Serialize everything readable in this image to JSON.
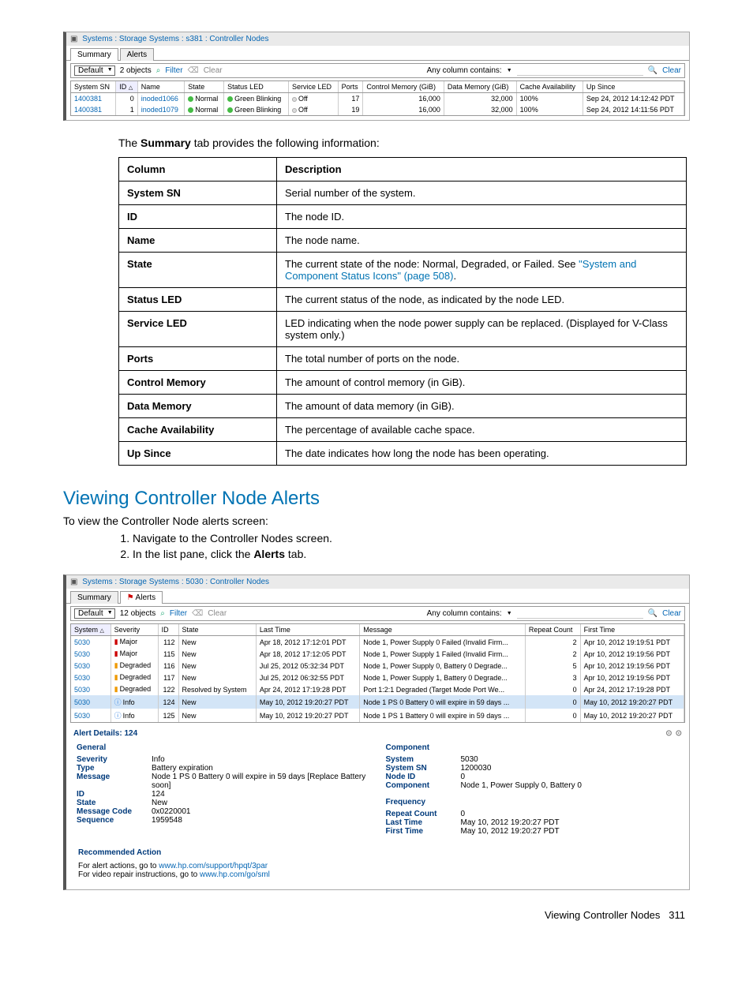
{
  "screenshot1": {
    "title": "Systems : Storage Systems : s381 : Controller Nodes",
    "tabs": [
      "Summary",
      "Alerts"
    ],
    "activeTab": 0,
    "toolbar": {
      "selector": "Default",
      "count": "2 objects",
      "filter": "Filter",
      "clear": "Clear",
      "searchLabel": "Any column contains:",
      "clearRight": "Clear"
    },
    "columns": [
      "System SN",
      "ID",
      "Name",
      "State",
      "Status LED",
      "Service LED",
      "Ports",
      "Control Memory (GiB)",
      "Data Memory (GiB)",
      "Cache Availability",
      "Up Since"
    ],
    "sortCol": 1,
    "rows": [
      {
        "sn": "1400381",
        "id": "0",
        "name": "inoded1066",
        "state": "Normal",
        "status": "Green Blinking",
        "service": "Off",
        "ports": "17",
        "cmem": "16,000",
        "dmem": "32,000",
        "cache": "100%",
        "up": "Sep 24, 2012 14:12:42 PDT"
      },
      {
        "sn": "1400381",
        "id": "1",
        "name": "inoded1079",
        "state": "Normal",
        "status": "Green Blinking",
        "service": "Off",
        "ports": "19",
        "cmem": "16,000",
        "dmem": "32,000",
        "cache": "100%",
        "up": "Sep 24, 2012 14:11:56 PDT"
      }
    ]
  },
  "bodyText1": {
    "pre": "The ",
    "bold": "Summary",
    "post": " tab provides the following information:"
  },
  "infoTable": {
    "headers": [
      "Column",
      "Description"
    ],
    "rows": [
      {
        "c": "System SN",
        "d": "Serial number of the system."
      },
      {
        "c": "ID",
        "d": "The node ID."
      },
      {
        "c": "Name",
        "d": "The node name."
      },
      {
        "c": "State",
        "d": "The current state of the node: Normal, Degraded, or Failed. See ",
        "link": "\"System and Component Status Icons\" (page 508)",
        "post": "."
      },
      {
        "c": "Status LED",
        "d": "The current status of the node, as indicated by the node LED."
      },
      {
        "c": "Service LED",
        "d": "LED indicating when the node power supply can be replaced. (Displayed for V-Class system only.)"
      },
      {
        "c": "Ports",
        "d": "The total number of ports on the node."
      },
      {
        "c": "Control Memory",
        "d": "The amount of control memory (in GiB)."
      },
      {
        "c": "Data Memory",
        "d": "The amount of data memory (in GiB)."
      },
      {
        "c": "Cache Availability",
        "d": "The percentage of available cache space."
      },
      {
        "c": "Up Since",
        "d": "The date indicates how long the node has been operating."
      }
    ]
  },
  "sectionHeading": "Viewing Controller Node Alerts",
  "sectionIntro": "To view the Controller Node alerts screen:",
  "steps": [
    "Navigate to the Controller Nodes screen.",
    {
      "pre": "In the list pane, click the ",
      "bold": "Alerts",
      "post": " tab."
    }
  ],
  "screenshot2": {
    "title": "Systems : Storage Systems : 5030 : Controller Nodes",
    "tabs": [
      "Summary",
      "Alerts"
    ],
    "activeTab": 1,
    "toolbar": {
      "selector": "Default",
      "count": "12 objects",
      "filter": "Filter",
      "clear": "Clear",
      "searchLabel": "Any column contains:",
      "clearRight": "Clear"
    },
    "columns": [
      "System",
      "Severity",
      "ID",
      "State",
      "Last Time",
      "Message",
      "Repeat Count",
      "First Time"
    ],
    "sortCol": 0,
    "rows": [
      {
        "sys": "5030",
        "sev": "Major",
        "sevCls": "sev-major",
        "id": "112",
        "state": "New",
        "last": "Apr 18, 2012 17:12:01 PDT",
        "msg": "Node 1, Power Supply 0 Failed (Invalid Firm...",
        "rc": "2",
        "first": "Apr 10, 2012 19:19:51 PDT"
      },
      {
        "sys": "5030",
        "sev": "Major",
        "sevCls": "sev-major",
        "id": "115",
        "state": "New",
        "last": "Apr 18, 2012 17:12:05 PDT",
        "msg": "Node 1, Power Supply 1 Failed (Invalid Firm...",
        "rc": "2",
        "first": "Apr 10, 2012 19:19:56 PDT"
      },
      {
        "sys": "5030",
        "sev": "Degraded",
        "sevCls": "sev-degraded",
        "id": "116",
        "state": "New",
        "last": "Jul 25, 2012 05:32:34 PDT",
        "msg": "Node 1, Power Supply 0, Battery 0 Degrade...",
        "rc": "5",
        "first": "Apr 10, 2012 19:19:56 PDT"
      },
      {
        "sys": "5030",
        "sev": "Degraded",
        "sevCls": "sev-degraded",
        "id": "117",
        "state": "New",
        "last": "Jul 25, 2012 06:32:55 PDT",
        "msg": "Node 1, Power Supply 1, Battery 0 Degrade...",
        "rc": "3",
        "first": "Apr 10, 2012 19:19:56 PDT"
      },
      {
        "sys": "5030",
        "sev": "Degraded",
        "sevCls": "sev-degraded",
        "id": "122",
        "state": "Resolved by System",
        "last": "Apr 24, 2012 17:19:28 PDT",
        "msg": "Port 1:2:1 Degraded (Target Mode Port We...",
        "rc": "0",
        "first": "Apr 24, 2012 17:19:28 PDT"
      },
      {
        "sys": "5030",
        "sev": "Info",
        "sevCls": "sev-info",
        "id": "124",
        "state": "New",
        "last": "May 10, 2012 19:20:27 PDT",
        "msg": "Node 1 PS 0 Battery 0 will expire in 59 days ...",
        "rc": "0",
        "first": "May 10, 2012 19:20:27 PDT",
        "selected": true
      },
      {
        "sys": "5030",
        "sev": "Info",
        "sevCls": "sev-info",
        "id": "125",
        "state": "New",
        "last": "May 10, 2012 19:20:27 PDT",
        "msg": "Node 1 PS 1 Battery 0 will expire in 59 days ...",
        "rc": "0",
        "first": "May 10, 2012 19:20:27 PDT"
      }
    ],
    "details": {
      "title": "Alert Details: 124",
      "general": {
        "heading": "General",
        "rows": [
          {
            "k": "Severity",
            "v": "Info"
          },
          {
            "k": "Type",
            "v": "Battery expiration"
          },
          {
            "k": "Message",
            "v": "Node 1 PS 0 Battery 0 will expire in 59 days [Replace Battery soon]"
          },
          {
            "k": "ID",
            "v": "124"
          },
          {
            "k": "State",
            "v": "New"
          },
          {
            "k": "Message Code",
            "v": "0x0220001"
          },
          {
            "k": "Sequence",
            "v": "1959548"
          }
        ]
      },
      "component": {
        "heading": "Component",
        "rows": [
          {
            "k": "System",
            "v": "5030"
          },
          {
            "k": "System SN",
            "v": "1200030"
          },
          {
            "k": "Node ID",
            "v": "0"
          },
          {
            "k": "Component",
            "v": "Node 1, Power Supply 0, Battery 0"
          }
        ]
      },
      "frequency": {
        "heading": "Frequency",
        "rows": [
          {
            "k": "Repeat Count",
            "v": "0"
          },
          {
            "k": "Last Time",
            "v": "May 10, 2012 19:20:27 PDT"
          },
          {
            "k": "First Time",
            "v": "May 10, 2012 19:20:27 PDT"
          }
        ]
      },
      "rec": {
        "heading": "Recommended Action",
        "line1a": "For alert actions, go to ",
        "link1": "www.hp.com/support/hpqt/3par",
        "line2a": "For video repair instructions, go to ",
        "link2": "www.hp.com/go/sml"
      }
    }
  },
  "footer": {
    "text": "Viewing Controller Nodes",
    "page": "311"
  }
}
